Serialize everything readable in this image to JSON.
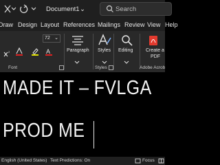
{
  "titlebar": {
    "document_title": "Document1",
    "title_chevron": "⌄",
    "search_placeholder": "Search"
  },
  "menu": {
    "items": [
      "Draw",
      "Design",
      "Layout",
      "References",
      "Mailings",
      "Review",
      "View",
      "Help"
    ]
  },
  "ribbon": {
    "font_size": "72",
    "font_size_chevron": "⌄",
    "font_group": "Font",
    "paragraph_label": "Paragraph",
    "styles_label": "Styles",
    "styles_group": "Styles",
    "editing_label": "Editing",
    "create_pdf_line1": "Create a",
    "create_pdf_line2": "PDF",
    "adobe_group": "Adobe Acrob"
  },
  "document": {
    "line1": "MADE IT – FVLGA",
    "line2": "PROD ME"
  },
  "statusbar": {
    "language": "English (United States)",
    "text_predictions": "Text Predictions: On",
    "focus": "Focus"
  },
  "colors": {
    "titlebar_bg": "#1f1f1f",
    "ribbon_bg": "#292929",
    "document_bg": "#000000",
    "text": "#f2f2f2",
    "pdf_icon_red": "#e23a2e"
  }
}
